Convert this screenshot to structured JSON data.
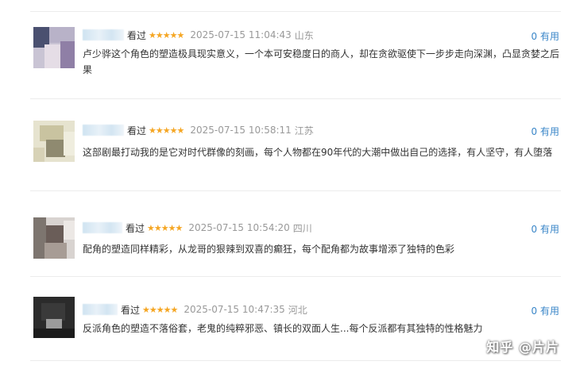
{
  "reviews": [
    {
      "status": "看过",
      "stars": "★★★★★",
      "time": "2025-07-15 11:04:43",
      "location": "山东",
      "useful": "0 有用",
      "content": "卢少骅这个角色的塑造极具现实意义，一个本可安稳度日的商人，却在贪欲驱使下一步步走向深渊，凸显贪婪之后果"
    },
    {
      "status": "看过",
      "stars": "★★★★★",
      "time": "2025-07-15 10:58:11",
      "location": "江苏",
      "useful": "0 有用",
      "content": "这部剧最打动我的是它对时代群像的刻画，每个人物都在90年代的大潮中做出自己的选择，有人坚守，有人堕落"
    },
    {
      "status": "看过",
      "stars": "★★★★★",
      "time": "2025-07-15 10:54:20",
      "location": "四川",
      "useful": "0 有用",
      "content": "配角的塑造同样精彩，从龙哥的狠辣到双喜的癫狂，每个配角都为故事增添了独特的色彩"
    },
    {
      "status": "看过",
      "stars": "★★★★★",
      "time": "2025-07-15 10:47:35",
      "location": "河北",
      "useful": "0 有用",
      "content": "反派角色的塑造不落俗套，老鬼的纯粹邪恶、镇长的双面人生...每个反派都有其独特的性格魅力"
    }
  ],
  "watermark": "知乎 @片片",
  "colors": {
    "star": "#f5a623",
    "link": "#3a86c8",
    "meta": "#999999"
  }
}
